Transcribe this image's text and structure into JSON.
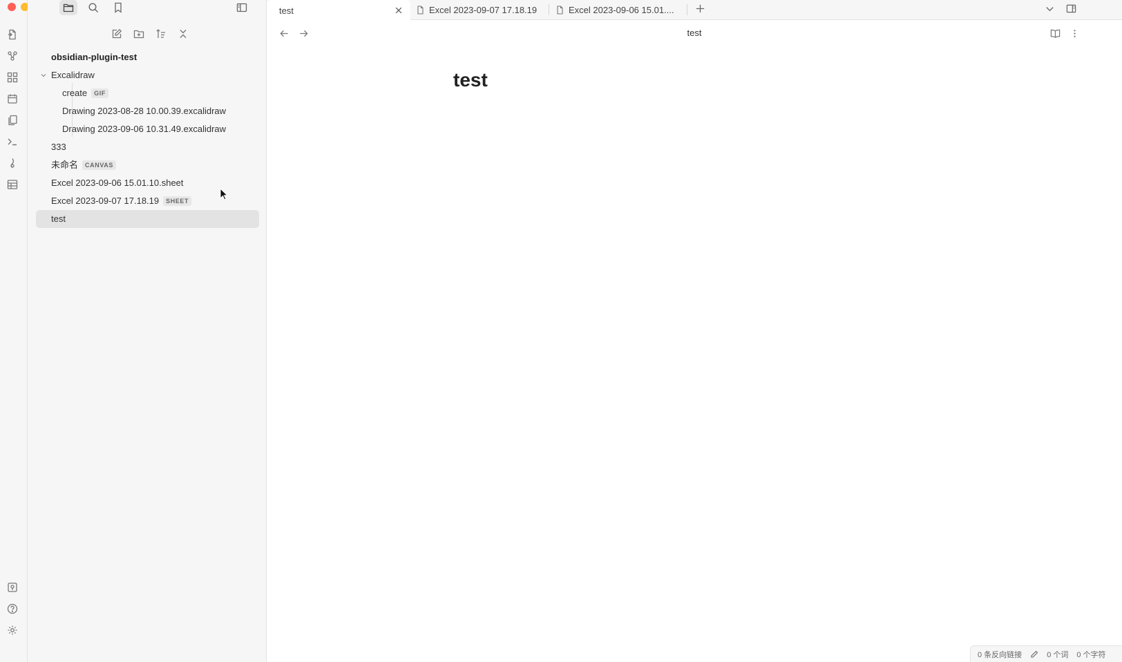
{
  "window": {
    "traffic_colors": [
      "#ff5f57",
      "#febc2e",
      "#28c840"
    ]
  },
  "ribbon": {
    "top_icons": [
      "switcher-icon",
      "graph-icon",
      "canvas-icon",
      "calendar-icon",
      "templates-icon",
      "terminal-icon",
      "excalidraw-icon",
      "table-icon"
    ],
    "bottom_icons": [
      "vault-icon",
      "help-icon",
      "settings-icon"
    ]
  },
  "sidebar": {
    "tabs": [
      "files-icon",
      "search-icon",
      "bookmark-icon"
    ],
    "actions": [
      "new-note-icon",
      "new-folder-icon",
      "sort-icon",
      "collapse-icon"
    ],
    "vault_name": "obsidian-plugin-test",
    "tree": [
      {
        "label": "Excalidraw",
        "badge": "",
        "level": 1,
        "folder": true
      },
      {
        "label": "create",
        "badge": "GIF",
        "level": 2
      },
      {
        "label": "Drawing 2023-08-28 10.00.39.excalidraw",
        "badge": "",
        "level": 2
      },
      {
        "label": "Drawing 2023-09-06 10.31.49.excalidraw",
        "badge": "",
        "level": 2
      },
      {
        "label": "333",
        "badge": "",
        "level": 1
      },
      {
        "label": "未命名",
        "badge": "CANVAS",
        "level": 1
      },
      {
        "label": "Excel 2023-09-06 15.01.10.sheet",
        "badge": "",
        "level": 1
      },
      {
        "label": "Excel 2023-09-07 17.18.19",
        "badge": "SHEET",
        "level": 1
      },
      {
        "label": "test",
        "badge": "",
        "level": 1,
        "active": true
      }
    ]
  },
  "tabs": [
    {
      "label": "test",
      "active": true
    },
    {
      "label": "Excel 2023-09-07 17.18.19"
    },
    {
      "label": "Excel 2023-09-06 15.01...."
    }
  ],
  "editor": {
    "header_title": "test",
    "note_title": "test"
  },
  "status": {
    "backlinks": "0 条反向链接",
    "words": "0 个词",
    "chars": "0 个字符"
  }
}
